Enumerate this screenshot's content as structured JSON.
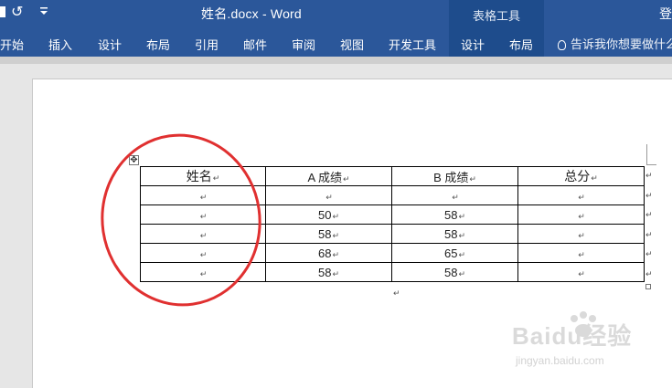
{
  "titlebar": {
    "undo_glyph": "↺",
    "qat_more_glyph": "⩡",
    "title": "姓名.docx - Word",
    "context_group": "表格工具",
    "login": "登"
  },
  "ribbon": {
    "tabs": [
      "开始",
      "插入",
      "设计",
      "布局",
      "引用",
      "邮件",
      "审阅",
      "视图",
      "开发工具"
    ],
    "context_tabs": [
      "设计",
      "布局"
    ],
    "tell_me": "告诉我你想要做什么"
  },
  "document": {
    "paragraph_mark": "↵",
    "table": {
      "headers": [
        "姓名",
        "A 成绩",
        "B 成绩",
        "总分"
      ],
      "rows": [
        [
          "",
          "",
          "",
          ""
        ],
        [
          "",
          "50",
          "58",
          ""
        ],
        [
          "",
          "58",
          "58",
          ""
        ],
        [
          "",
          "68",
          "65",
          ""
        ],
        [
          "",
          "58",
          "58",
          ""
        ]
      ]
    },
    "move_handle_glyph": "✥"
  },
  "watermark": {
    "brand": "Baidu经验",
    "url": "jingyan.baidu.com"
  },
  "colors": {
    "ribbon": "#2b579a",
    "context_group": "#1e4c8c",
    "annotation_circle": "#e03030"
  }
}
